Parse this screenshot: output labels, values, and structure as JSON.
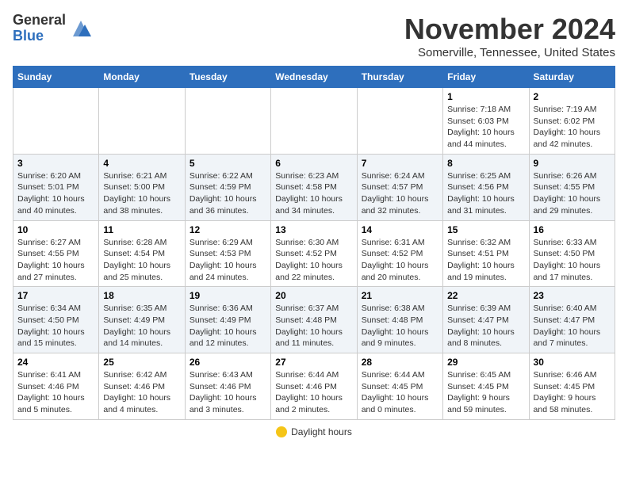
{
  "header": {
    "logo_general": "General",
    "logo_blue": "Blue",
    "month_title": "November 2024",
    "location": "Somerville, Tennessee, United States"
  },
  "weekdays": [
    "Sunday",
    "Monday",
    "Tuesday",
    "Wednesday",
    "Thursday",
    "Friday",
    "Saturday"
  ],
  "legend": {
    "label": "Daylight hours"
  },
  "weeks": [
    [
      {
        "day": "",
        "info": ""
      },
      {
        "day": "",
        "info": ""
      },
      {
        "day": "",
        "info": ""
      },
      {
        "day": "",
        "info": ""
      },
      {
        "day": "",
        "info": ""
      },
      {
        "day": "1",
        "info": "Sunrise: 7:18 AM\nSunset: 6:03 PM\nDaylight: 10 hours and 44 minutes."
      },
      {
        "day": "2",
        "info": "Sunrise: 7:19 AM\nSunset: 6:02 PM\nDaylight: 10 hours and 42 minutes."
      }
    ],
    [
      {
        "day": "3",
        "info": "Sunrise: 6:20 AM\nSunset: 5:01 PM\nDaylight: 10 hours and 40 minutes."
      },
      {
        "day": "4",
        "info": "Sunrise: 6:21 AM\nSunset: 5:00 PM\nDaylight: 10 hours and 38 minutes."
      },
      {
        "day": "5",
        "info": "Sunrise: 6:22 AM\nSunset: 4:59 PM\nDaylight: 10 hours and 36 minutes."
      },
      {
        "day": "6",
        "info": "Sunrise: 6:23 AM\nSunset: 4:58 PM\nDaylight: 10 hours and 34 minutes."
      },
      {
        "day": "7",
        "info": "Sunrise: 6:24 AM\nSunset: 4:57 PM\nDaylight: 10 hours and 32 minutes."
      },
      {
        "day": "8",
        "info": "Sunrise: 6:25 AM\nSunset: 4:56 PM\nDaylight: 10 hours and 31 minutes."
      },
      {
        "day": "9",
        "info": "Sunrise: 6:26 AM\nSunset: 4:55 PM\nDaylight: 10 hours and 29 minutes."
      }
    ],
    [
      {
        "day": "10",
        "info": "Sunrise: 6:27 AM\nSunset: 4:55 PM\nDaylight: 10 hours and 27 minutes."
      },
      {
        "day": "11",
        "info": "Sunrise: 6:28 AM\nSunset: 4:54 PM\nDaylight: 10 hours and 25 minutes."
      },
      {
        "day": "12",
        "info": "Sunrise: 6:29 AM\nSunset: 4:53 PM\nDaylight: 10 hours and 24 minutes."
      },
      {
        "day": "13",
        "info": "Sunrise: 6:30 AM\nSunset: 4:52 PM\nDaylight: 10 hours and 22 minutes."
      },
      {
        "day": "14",
        "info": "Sunrise: 6:31 AM\nSunset: 4:52 PM\nDaylight: 10 hours and 20 minutes."
      },
      {
        "day": "15",
        "info": "Sunrise: 6:32 AM\nSunset: 4:51 PM\nDaylight: 10 hours and 19 minutes."
      },
      {
        "day": "16",
        "info": "Sunrise: 6:33 AM\nSunset: 4:50 PM\nDaylight: 10 hours and 17 minutes."
      }
    ],
    [
      {
        "day": "17",
        "info": "Sunrise: 6:34 AM\nSunset: 4:50 PM\nDaylight: 10 hours and 15 minutes."
      },
      {
        "day": "18",
        "info": "Sunrise: 6:35 AM\nSunset: 4:49 PM\nDaylight: 10 hours and 14 minutes."
      },
      {
        "day": "19",
        "info": "Sunrise: 6:36 AM\nSunset: 4:49 PM\nDaylight: 10 hours and 12 minutes."
      },
      {
        "day": "20",
        "info": "Sunrise: 6:37 AM\nSunset: 4:48 PM\nDaylight: 10 hours and 11 minutes."
      },
      {
        "day": "21",
        "info": "Sunrise: 6:38 AM\nSunset: 4:48 PM\nDaylight: 10 hours and 9 minutes."
      },
      {
        "day": "22",
        "info": "Sunrise: 6:39 AM\nSunset: 4:47 PM\nDaylight: 10 hours and 8 minutes."
      },
      {
        "day": "23",
        "info": "Sunrise: 6:40 AM\nSunset: 4:47 PM\nDaylight: 10 hours and 7 minutes."
      }
    ],
    [
      {
        "day": "24",
        "info": "Sunrise: 6:41 AM\nSunset: 4:46 PM\nDaylight: 10 hours and 5 minutes."
      },
      {
        "day": "25",
        "info": "Sunrise: 6:42 AM\nSunset: 4:46 PM\nDaylight: 10 hours and 4 minutes."
      },
      {
        "day": "26",
        "info": "Sunrise: 6:43 AM\nSunset: 4:46 PM\nDaylight: 10 hours and 3 minutes."
      },
      {
        "day": "27",
        "info": "Sunrise: 6:44 AM\nSunset: 4:46 PM\nDaylight: 10 hours and 2 minutes."
      },
      {
        "day": "28",
        "info": "Sunrise: 6:44 AM\nSunset: 4:45 PM\nDaylight: 10 hours and 0 minutes."
      },
      {
        "day": "29",
        "info": "Sunrise: 6:45 AM\nSunset: 4:45 PM\nDaylight: 9 hours and 59 minutes."
      },
      {
        "day": "30",
        "info": "Sunrise: 6:46 AM\nSunset: 4:45 PM\nDaylight: 9 hours and 58 minutes."
      }
    ]
  ]
}
